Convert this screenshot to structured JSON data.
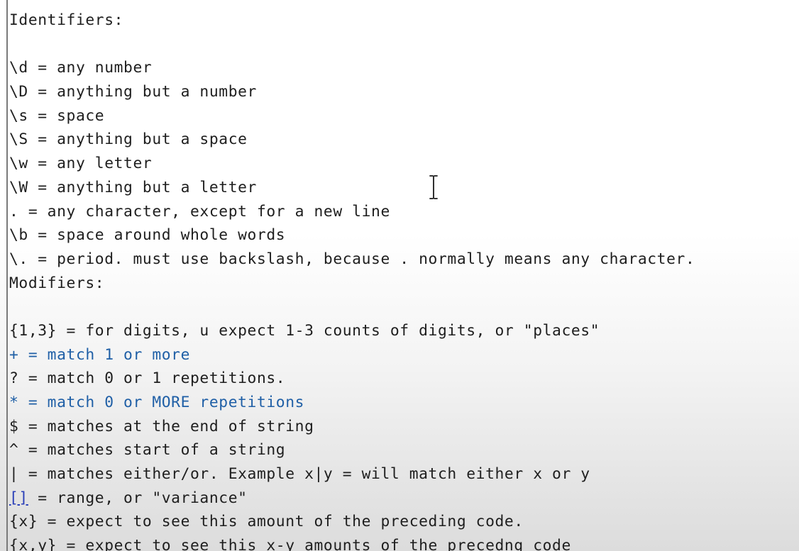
{
  "lines": [
    "Identifiers:",
    "",
    "\\d = any number",
    "\\D = anything but a number",
    "\\s = space",
    "\\S = anything but a space",
    "\\w = any letter",
    "\\W = anything but a letter",
    ". = any character, except for a new line",
    "\\b = space around whole words",
    "\\. = period. must use backslash, because . normally means any character.",
    "Modifiers:",
    "",
    "{1,3} = for digits, u expect 1-3 counts of digits, or \"places\"",
    "+ = match 1 or more",
    "? = match 0 or 1 repetitions.",
    "* = match 0 or MORE repetitions",
    "$ = matches at the end of string",
    "^ = matches start of a string",
    "| = matches either/or. Example x|y = will match either x or y",
    "[] = range, or \"variance\"",
    "{x} = expect to see this amount of the preceding code.",
    "{x,y} = expect to see this x-y amounts of the precedng code"
  ],
  "range_line": {
    "brackets": "[]",
    "rest": " = range, or \"variance\""
  },
  "colors": {
    "text": "#1e1e1e",
    "highlight_blue": "#1f5fa6",
    "bracket_match": "#2a3fb8"
  },
  "cursor_icon": "i-beam-cursor-icon"
}
